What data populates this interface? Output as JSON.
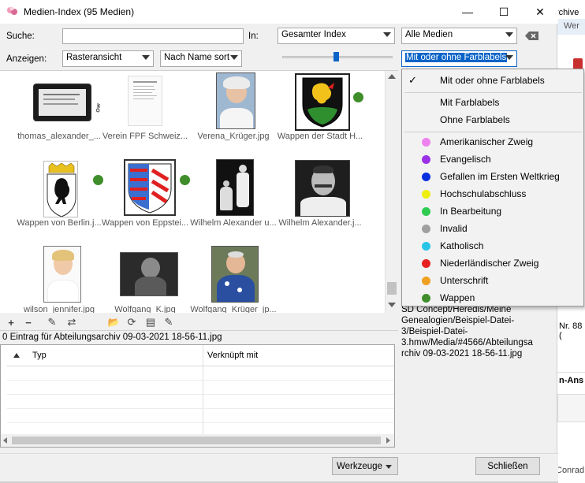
{
  "window": {
    "title": "Medien-Index (95 Medien)",
    "minimize": "—",
    "maximize": "☐",
    "close": "✕"
  },
  "background_window": {
    "text_top": "rchive",
    "text_top2": "Wer",
    "text_nr": "Nr. 88 (",
    "text_n": "n-Ans",
    "text_conr": "Conrad"
  },
  "search": {
    "label": "Suche:",
    "value": "",
    "in_label": "In:",
    "scope": "Gesamter Index",
    "media_filter": "Alle Medien"
  },
  "view": {
    "label": "Anzeigen:",
    "mode": "Rasteransicht",
    "sort": "Nach Name sort",
    "color_filter": "Mit oder ohne Farblabels"
  },
  "grid": {
    "items": [
      {
        "caption": "thomas_alexander_..."
      },
      {
        "caption": "Verein FPF Schweiz..."
      },
      {
        "caption": "Verena_Krüger.jpg"
      },
      {
        "caption": "Wappen der Stadt H..."
      },
      {
        "caption": "Wappen von Berlin.j..."
      },
      {
        "caption": "Wappen von Eppstei..."
      },
      {
        "caption": "Wilhelm Alexander u..."
      },
      {
        "caption": "Wilhelm Alexander.j..."
      },
      {
        "caption": "wilson_jennifer.jpg"
      },
      {
        "caption": "Wolfgang_K.jpg"
      },
      {
        "caption": "Wolfgang_Krüger_jp..."
      }
    ]
  },
  "toolbar": {
    "add": "+",
    "remove": "−",
    "edit": "✎",
    "merge": "⇄",
    "open": "📂",
    "refresh": "⟳",
    "save": "▤",
    "details": "✎"
  },
  "links": {
    "info": "0 Eintrag für Abteilungsarchiv 09-03-2021 18-56-11.jpg",
    "col_type": "Typ",
    "col_linked": "Verknüpft mit"
  },
  "details": {
    "path_lines": [
      "SD Concept/Heredis/Meine",
      "Genealogien/Beispiel-Datei-",
      "3/Beispiel-Datei-",
      "3.hmw/Media/#4566/Abteilungsa",
      "rchiv 09-03-2021 18-56-11.jpg"
    ]
  },
  "buttons": {
    "tools": "Werkzeuge",
    "close": "Schließen"
  },
  "color_menu": {
    "checked": "Mit oder ohne Farblabels",
    "with": "Mit Farblabels",
    "without": "Ohne Farblabels",
    "labels": [
      {
        "name": "Amerikanischer Zweig",
        "color": "#ee82ee"
      },
      {
        "name": "Evangelisch",
        "color": "#9b30e8"
      },
      {
        "name": "Gefallen im Ersten Weltkrieg",
        "color": "#0a2fe0"
      },
      {
        "name": "Hochschulabschluss",
        "color": "#eeee10"
      },
      {
        "name": "In Bearbeitung",
        "color": "#2ecc50"
      },
      {
        "name": "Invalid",
        "color": "#a0a0a0"
      },
      {
        "name": "Katholisch",
        "color": "#28c4e8"
      },
      {
        "name": "Niederländischer Zweig",
        "color": "#e62020"
      },
      {
        "name": "Unterschrift",
        "color": "#f0a020"
      },
      {
        "name": "Wappen",
        "color": "#3f8e2b"
      }
    ]
  }
}
